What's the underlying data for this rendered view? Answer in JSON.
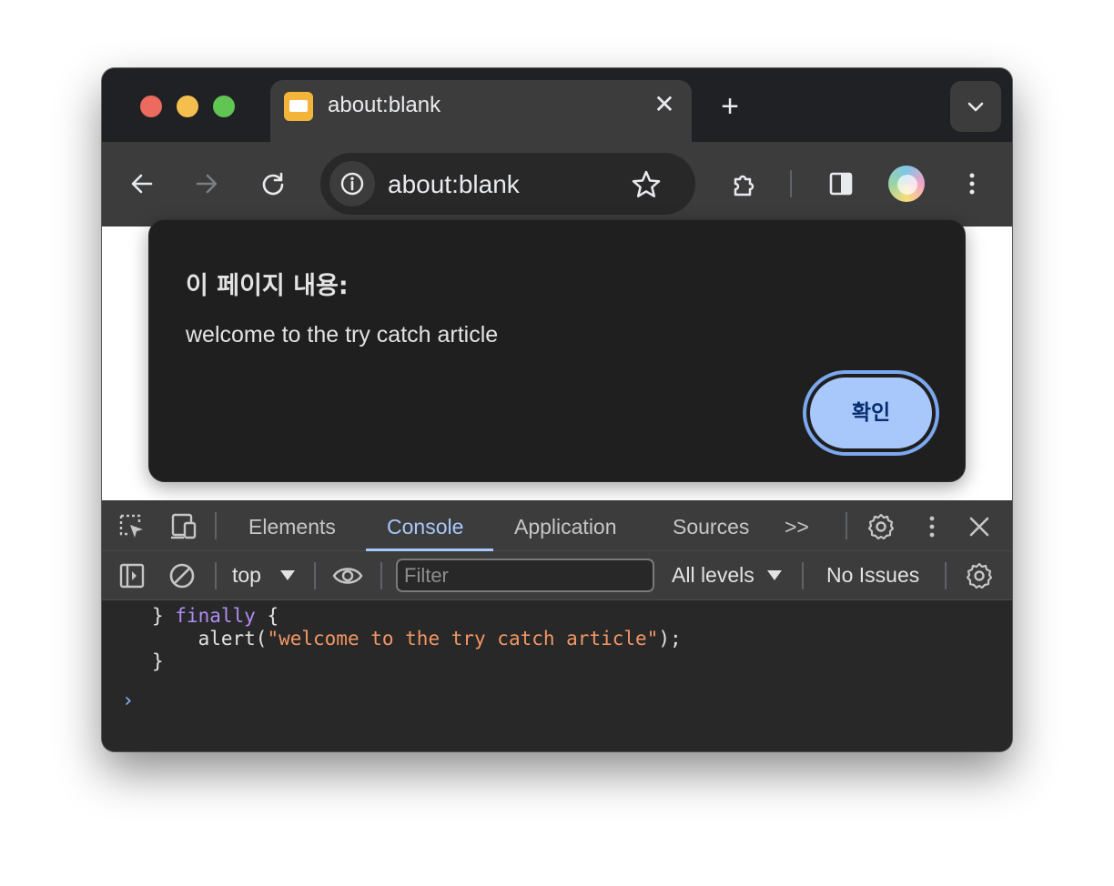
{
  "tab": {
    "title": "about:blank",
    "close_glyph": "✕",
    "favicon": "page-favicon-icon"
  },
  "new_tab_glyph": "+",
  "omnibox": {
    "url": "about:blank"
  },
  "dialog": {
    "title": "이 페이지 내용:",
    "message": "welcome to the try catch article",
    "ok_label": "확인"
  },
  "devtools": {
    "tabs": [
      "Elements",
      "Console",
      "Application",
      "Sources"
    ],
    "more_tabs_glyph": ">>",
    "context": "top",
    "filter_placeholder": "Filter",
    "levels": "All levels",
    "issues": "No Issues"
  },
  "console": {
    "lines": [
      {
        "pre": "} ",
        "kw": "finally",
        "post": " {"
      },
      {
        "pre": "    alert(",
        "str": "\"welcome to the try catch article\"",
        "post": ");"
      },
      {
        "pre": "}"
      }
    ],
    "prompt_glyph": "›"
  },
  "colors": {
    "accent": "#a8c7fa",
    "string": "#f29766",
    "keyword": "#b08cf5"
  }
}
